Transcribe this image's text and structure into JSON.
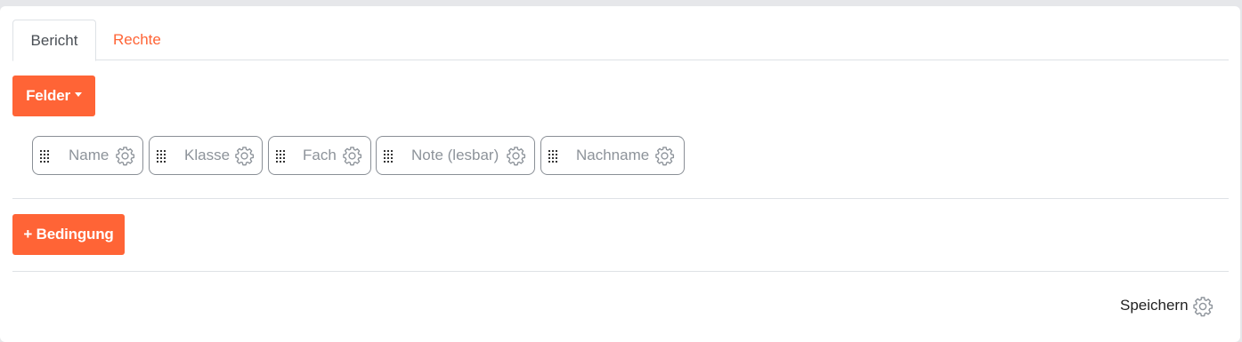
{
  "tabs": [
    {
      "label": "Bericht",
      "active": true
    },
    {
      "label": "Rechte",
      "active": false
    }
  ],
  "fields_button": {
    "label": "Felder"
  },
  "chips": [
    {
      "label": "Name"
    },
    {
      "label": "Klasse"
    },
    {
      "label": "Fach"
    },
    {
      "label": "Note (lesbar)"
    },
    {
      "label": "Nachname"
    }
  ],
  "condition_button": {
    "label": "+ Bedingung"
  },
  "save": {
    "label": "Speichern"
  },
  "colors": {
    "accent": "#ff6436",
    "chip_border": "#8a8f96",
    "chip_text": "#8d939a",
    "divider": "#dee2e6"
  },
  "icons": [
    "grip-icon",
    "gear-icon",
    "caret-down-icon"
  ]
}
